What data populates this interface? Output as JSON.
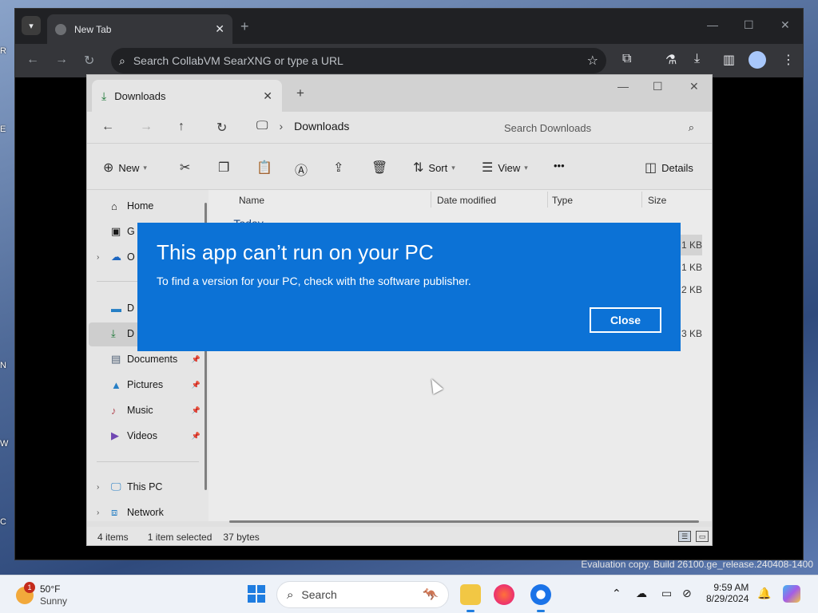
{
  "desktop": {
    "edge_letters": [
      "R",
      "E",
      "N",
      "W",
      "C"
    ],
    "watermark": "Evaluation copy. Build 26100.ge_release.240408-1400"
  },
  "browser": {
    "tab_title": "New Tab",
    "omnibox_placeholder": "Search CollabVM SearXNG or type a URL"
  },
  "explorer": {
    "tab_title": "Downloads",
    "breadcrumb": "Downloads",
    "search_placeholder": "Search Downloads",
    "commands": {
      "new": "New",
      "sort": "Sort",
      "view": "View",
      "more": "•••",
      "details": "Details"
    },
    "nav": {
      "home": "Home",
      "gallery": "G",
      "onedrive": "O",
      "desktop": "D",
      "downloads": "D",
      "documents": "Documents",
      "pictures": "Pictures",
      "music": "Music",
      "videos": "Videos",
      "this_pc": "This PC",
      "network": "Network"
    },
    "columns": {
      "name": "Name",
      "date_modified": "Date modified",
      "type": "Type",
      "size": "Size"
    },
    "group_label": "Today",
    "row_sizes": [
      "1 KB",
      "1 KB",
      "2 KB",
      "3 KB"
    ],
    "status": {
      "items": "4 items",
      "selected": "1 item selected",
      "bytes": "37 bytes"
    }
  },
  "dialog": {
    "title": "This app can’t run on your PC",
    "message": "To find a version for your PC, check with the software publisher.",
    "close_label": "Close"
  },
  "taskbar": {
    "weather_badge": "1",
    "weather_temp": "50°F",
    "weather_condition": "Sunny",
    "search_label": "Search",
    "time": "9:59 AM",
    "date": "8/29/2024"
  }
}
